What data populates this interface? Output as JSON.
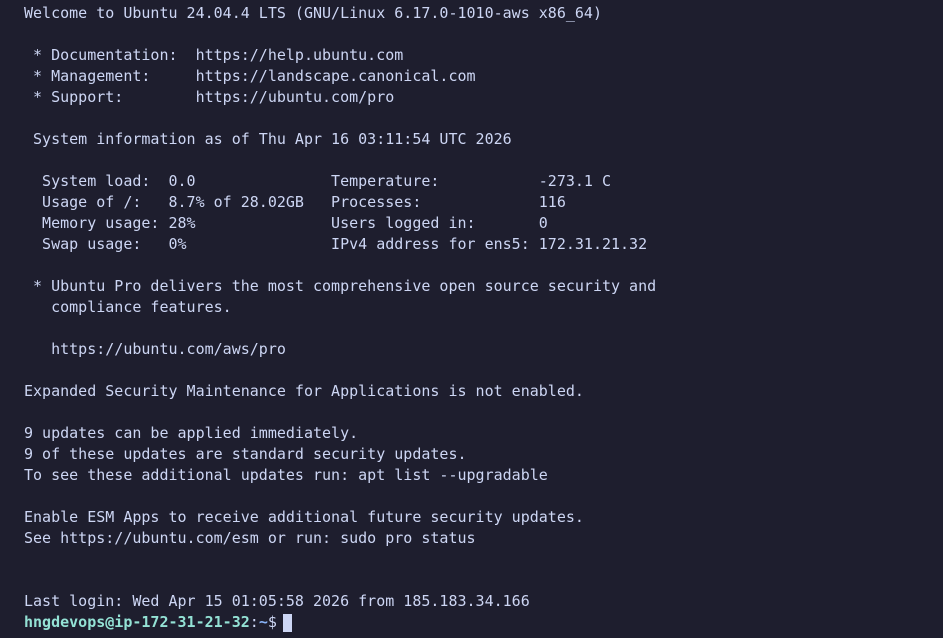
{
  "terminal": {
    "lines": [
      "Welcome to Ubuntu 24.04.4 LTS (GNU/Linux 6.17.0-1010-aws x86_64)",
      "",
      " * Documentation:  https://help.ubuntu.com",
      " * Management:     https://landscape.canonical.com",
      " * Support:        https://ubuntu.com/pro",
      "",
      " System information as of Thu Apr 16 03:11:54 UTC 2026",
      "",
      "  System load:  0.0               Temperature:           -273.1 C",
      "  Usage of /:   8.7% of 28.02GB   Processes:             116",
      "  Memory usage: 28%               Users logged in:       0",
      "  Swap usage:   0%                IPv4 address for ens5: 172.31.21.32",
      "",
      " * Ubuntu Pro delivers the most comprehensive open source security and",
      "   compliance features.",
      "",
      "   https://ubuntu.com/aws/pro",
      "",
      "Expanded Security Maintenance for Applications is not enabled.",
      "",
      "9 updates can be applied immediately.",
      "9 of these updates are standard security updates.",
      "To see these additional updates run: apt list --upgradable",
      "",
      "Enable ESM Apps to receive additional future security updates.",
      "See https://ubuntu.com/esm or run: sudo pro status",
      "",
      "",
      "Last login: Wed Apr 15 01:05:58 2026 from 185.183.34.166"
    ],
    "prompt": {
      "user_host": "hngdevops@ip-172-31-21-32",
      "separator": ":",
      "path": "~",
      "symbol": "$"
    }
  },
  "colors": {
    "background": "#1e1e2e",
    "foreground": "#cdd6f4",
    "prompt_user": "#94e2d5",
    "prompt_path": "#89b4fa"
  }
}
